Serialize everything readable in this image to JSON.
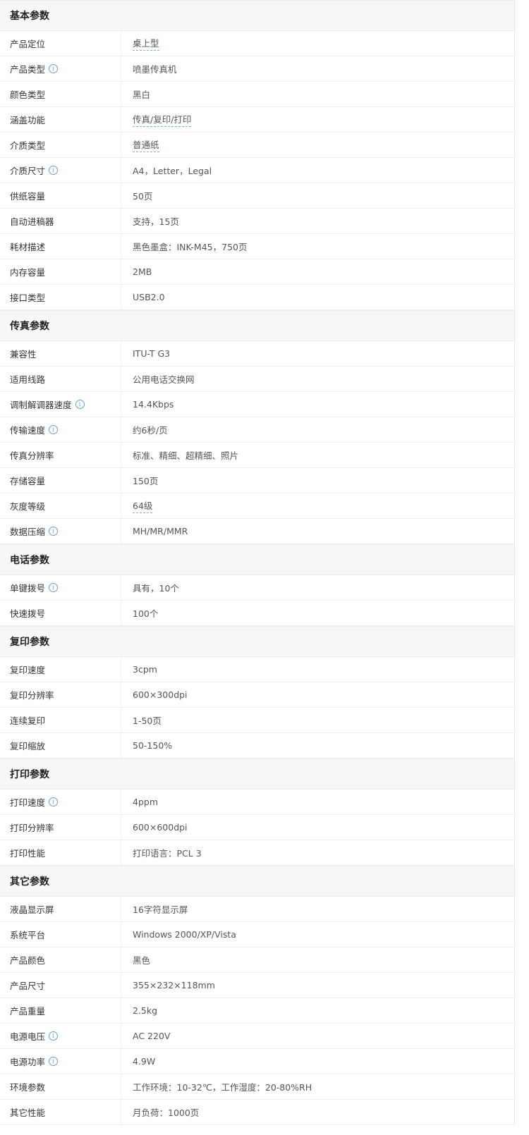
{
  "accent_color": "#5aa2e6",
  "sections": [
    {
      "title": "基本参数",
      "rows": [
        {
          "key": "产品定位",
          "value": "桌上型",
          "info": false,
          "link": true
        },
        {
          "key": "产品类型",
          "value": "喷墨传真机",
          "info": true,
          "link": false
        },
        {
          "key": "颜色类型",
          "value": "黑白",
          "info": false,
          "link": false
        },
        {
          "key": "涵盖功能",
          "value": "传真/复印/打印",
          "info": false,
          "link": true
        },
        {
          "key": "介质类型",
          "value": "普通纸",
          "info": false,
          "link": true
        },
        {
          "key": "介质尺寸",
          "value": "A4，Letter，Legal",
          "info": true,
          "link": false
        },
        {
          "key": "供纸容量",
          "value": "50页",
          "info": false,
          "link": false
        },
        {
          "key": "自动进稿器",
          "value": "支持，15页",
          "info": false,
          "link": false
        },
        {
          "key": "耗材描述",
          "value": "黑色墨盒：INK-M45，750页",
          "info": false,
          "link": false
        },
        {
          "key": "内存容量",
          "value": "2MB",
          "info": false,
          "link": false
        },
        {
          "key": "接口类型",
          "value": "USB2.0",
          "info": false,
          "link": false
        }
      ]
    },
    {
      "title": "传真参数",
      "rows": [
        {
          "key": "兼容性",
          "value": "ITU-T G3",
          "info": false,
          "link": false
        },
        {
          "key": "适用线路",
          "value": "公用电话交换网",
          "info": false,
          "link": false
        },
        {
          "key": "调制解调器速度",
          "value": "14.4Kbps",
          "info": true,
          "link": false
        },
        {
          "key": "传输速度",
          "value": "约6秒/页",
          "info": true,
          "link": false
        },
        {
          "key": "传真分辨率",
          "value": "标准、精细、超精细、照片",
          "info": false,
          "link": false
        },
        {
          "key": "存储容量",
          "value": "150页",
          "info": false,
          "link": false
        },
        {
          "key": "灰度等级",
          "value": "64级",
          "info": false,
          "link": true
        },
        {
          "key": "数据压缩",
          "value": "MH/MR/MMR",
          "info": true,
          "link": false
        }
      ]
    },
    {
      "title": "电话参数",
      "rows": [
        {
          "key": "单键拨号",
          "value": "具有，10个",
          "info": true,
          "link": false
        },
        {
          "key": "快速拨号",
          "value": "100个",
          "info": false,
          "link": false
        }
      ]
    },
    {
      "title": "复印参数",
      "rows": [
        {
          "key": "复印速度",
          "value": "3cpm",
          "info": false,
          "link": false
        },
        {
          "key": "复印分辨率",
          "value": "600×300dpi",
          "info": false,
          "link": false
        },
        {
          "key": "连续复印",
          "value": "1-50页",
          "info": false,
          "link": false
        },
        {
          "key": "复印缩放",
          "value": "50-150%",
          "info": false,
          "link": false
        }
      ]
    },
    {
      "title": "打印参数",
      "rows": [
        {
          "key": "打印速度",
          "value": "4ppm",
          "info": true,
          "link": false
        },
        {
          "key": "打印分辨率",
          "value": "600×600dpi",
          "info": false,
          "link": false
        },
        {
          "key": "打印性能",
          "value": "打印语言：PCL 3",
          "info": false,
          "link": false
        }
      ]
    },
    {
      "title": "其它参数",
      "rows": [
        {
          "key": "液晶显示屏",
          "value": "16字符显示屏",
          "info": false,
          "link": false
        },
        {
          "key": "系统平台",
          "value": "Windows 2000/XP/Vista",
          "info": false,
          "link": false
        },
        {
          "key": "产品颜色",
          "value": "黑色",
          "info": false,
          "link": false
        },
        {
          "key": "产品尺寸",
          "value": "355×232×118mm",
          "info": false,
          "link": false
        },
        {
          "key": "产品重量",
          "value": "2.5kg",
          "info": false,
          "link": false
        },
        {
          "key": "电源电压",
          "value": "AC 220V",
          "info": true,
          "link": false
        },
        {
          "key": "电源功率",
          "value": "4.9W",
          "info": true,
          "link": false
        },
        {
          "key": "环境参数",
          "value": "工作环境：10-32℃，工作湿度：20-80%RH",
          "info": false,
          "link": false
        },
        {
          "key": "其它性能",
          "value": "月负荷：1000页",
          "info": false,
          "link": false
        }
      ]
    }
  ]
}
